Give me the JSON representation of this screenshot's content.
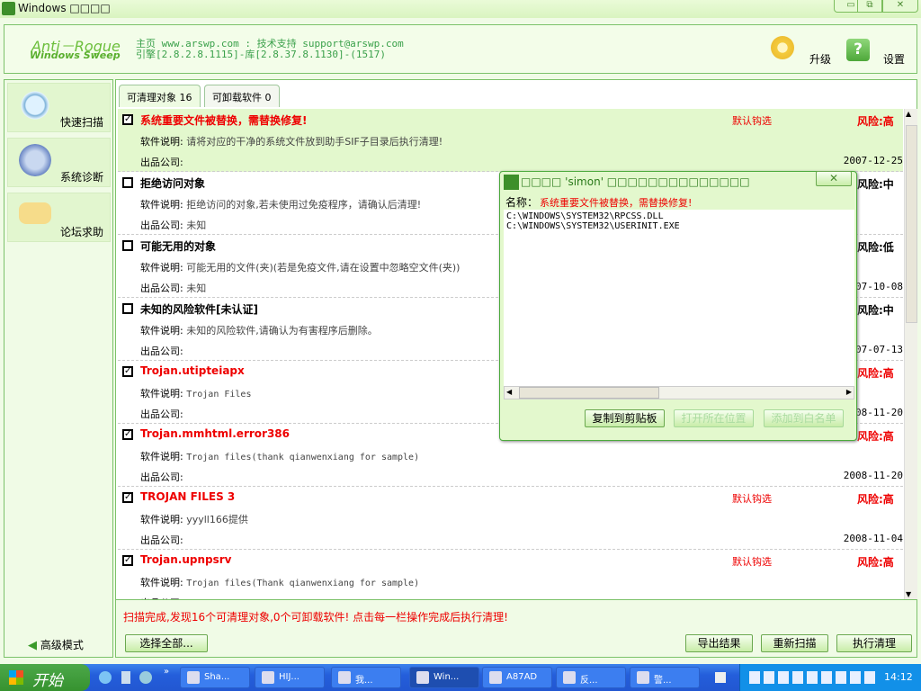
{
  "window": {
    "title": "Windows □□□□",
    "minimize": "▭",
    "restore": "⧉",
    "close": "✕"
  },
  "header": {
    "logo_line1": "Anti－Rogue",
    "logo_line2": "Windows Sweep",
    "info_line1": "主页 www.arswp.com : 技术支持 support@arswp.com",
    "info_line2": "引擎[2.8.2.8.1115]-库[2.8.37.8.1130]-(1517)",
    "upgrade": "升级",
    "settings": "设置"
  },
  "sidebar": {
    "items": [
      {
        "label": "快速扫描",
        "icon": "magnifier-icon"
      },
      {
        "label": "系统诊断",
        "icon": "diagnose-icon"
      },
      {
        "label": "论坛求助",
        "icon": "chat-icon"
      }
    ],
    "advanced": "高级模式"
  },
  "tabs": [
    {
      "label": "可清理对象 16"
    },
    {
      "label": "可卸载软件 0"
    }
  ],
  "list": {
    "desc_label": "软件说明:",
    "company_label": "出品公司:",
    "items": [
      {
        "checked": true,
        "name": "系统重要文件被替换，需替换修复!",
        "desc": "请将对应的干净的系统文件放到助手SIF子目录后执行清理!",
        "company": "",
        "default": "默认钩选",
        "risk": "风险:高",
        "date": "2007-12-25",
        "danger": true
      },
      {
        "checked": false,
        "name": "拒绝访问对象",
        "desc": "拒绝访问的对象,若未使用过免疫程序，请确认后清理!",
        "company": "未知",
        "default": "",
        "risk": "风险:中",
        "date": "",
        "danger": false
      },
      {
        "checked": false,
        "name": "可能无用的对象",
        "desc": "可能无用的文件(夹)(若是免疫文件,请在设置中忽略空文件(夹))",
        "company": "未知",
        "default": "",
        "risk": "风险:低",
        "date": "2007-10-08",
        "danger": false
      },
      {
        "checked": false,
        "name": "未知的风险软件[未认证]",
        "desc": "未知的风险软件,请确认为有害程序后删除。",
        "company": "",
        "default": "",
        "risk": "风险:中",
        "date": "2007-07-13",
        "danger": false
      },
      {
        "checked": true,
        "name": "Trojan.utipteiapx",
        "desc": "Trojan Files",
        "company": "",
        "default": "",
        "risk": "风险:高",
        "date": "2008-11-20",
        "danger": true
      },
      {
        "checked": true,
        "name": "Trojan.mmhtml.error386",
        "desc": "Trojan files(thank qianwenxiang for sample)",
        "company": "",
        "default": "",
        "risk": "风险:高",
        "date": "2008-11-20",
        "danger": true
      },
      {
        "checked": true,
        "name": "TROJAN FILES 3",
        "desc": "yyyll166提供",
        "company": "",
        "default": "默认钩选",
        "risk": "风险:高",
        "date": "2008-11-04",
        "danger": true
      },
      {
        "checked": true,
        "name": "Trojan.upnpsrv",
        "desc": "Trojan files(Thank qianwenxiang for sample)",
        "company": "",
        "default": "默认钩选",
        "risk": "风险:高",
        "date": "",
        "danger": true
      }
    ]
  },
  "status": "扫描完成,发现16个可清理对象,0个可卸载软件! 点击每一栏操作完成后执行清理!",
  "buttons": {
    "select_all": "选择全部...",
    "export": "导出结果",
    "rescan": "重新扫描",
    "clean": "执行清理"
  },
  "dialog": {
    "title": "□□□□ 'simon' □□□□□□□□□□□□□□",
    "name_label": "名称：",
    "name_value": "系统重要文件被替换，需替换修复!",
    "files": [
      "C:\\WINDOWS\\SYSTEM32\\RPCSS.DLL",
      "C:\\WINDOWS\\SYSTEM32\\USERINIT.EXE"
    ],
    "copy": "复制到剪贴板",
    "open_location": "打开所在位置",
    "add_whitelist": "添加到白名单",
    "close": "✕"
  },
  "taskbar": {
    "start": "开始",
    "tasks": [
      "Sha...",
      "HIJ...",
      "我...",
      "Win...",
      "A87AD",
      "反...",
      "警..."
    ],
    "clock": "14:12"
  }
}
